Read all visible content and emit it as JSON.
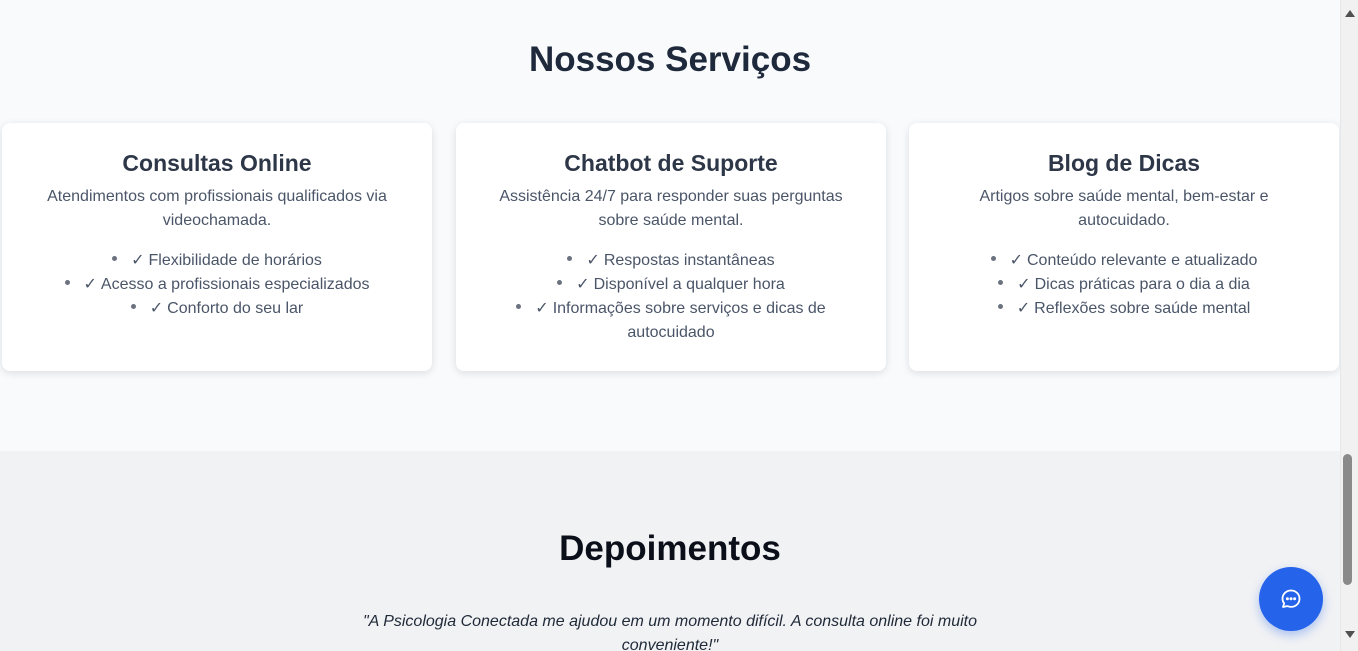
{
  "services": {
    "title": "Nossos Serviços",
    "cards": [
      {
        "title": "Consultas Online",
        "description": "Atendimentos com profissionais qualificados via videochamada.",
        "features": [
          "Flexibilidade de horários",
          "Acesso a profissionais especializados",
          "Conforto do seu lar"
        ]
      },
      {
        "title": "Chatbot de Suporte",
        "description": "Assistência 24/7 para responder suas perguntas sobre saúde mental.",
        "features": [
          "Respostas instantâneas",
          "Disponível a qualquer hora",
          "Informações sobre serviços e dicas de autocuidado"
        ]
      },
      {
        "title": "Blog de Dicas",
        "description": "Artigos sobre saúde mental, bem-estar e autocuidado.",
        "features": [
          "Conteúdo relevante e atualizado",
          "Dicas práticas para o dia a dia",
          "Reflexões sobre saúde mental"
        ]
      }
    ],
    "check_mark": "✓"
  },
  "testimonials": {
    "title": "Depoimentos",
    "quote": "\"A Psicologia Conectada me ajudou em um momento difícil. A consulta online foi muito conveniente!\""
  },
  "chat_button": {
    "icon": "chat-bubble-icon",
    "color": "#2563eb"
  },
  "colors": {
    "accent": "#2563eb",
    "heading": "#1e293b",
    "text": "#4a5568"
  }
}
